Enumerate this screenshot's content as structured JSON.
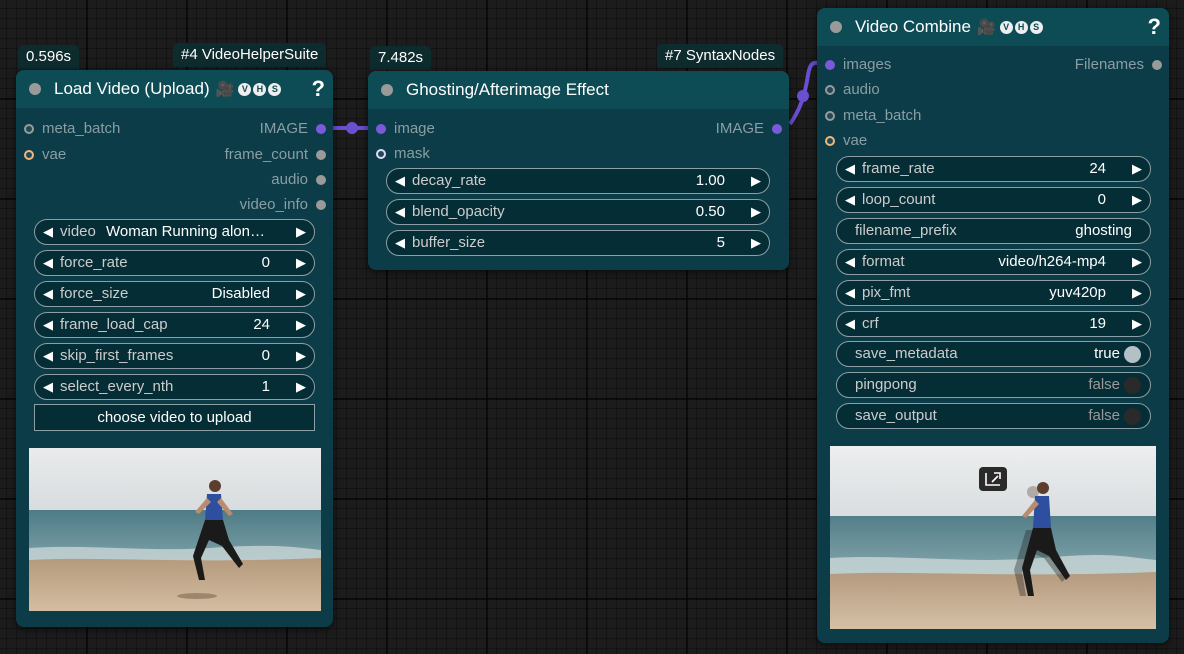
{
  "colors": {
    "node_bg": "#0b3c48",
    "node_header": "#0d4b55",
    "link": "#6a4fd1",
    "badge": "#0e2b2d"
  },
  "node_load": {
    "time": "0.596s",
    "id_badge": "#4 VideoHelperSuite",
    "title": "Load Video (Upload)",
    "help": "?",
    "inputs": [
      "meta_batch",
      "vae"
    ],
    "outputs": [
      "IMAGE",
      "frame_count",
      "audio",
      "video_info"
    ],
    "widgets": [
      {
        "label": "video",
        "value": "Woman Running alon…"
      },
      {
        "label": "force_rate",
        "value": "0"
      },
      {
        "label": "force_size",
        "value": "Disabled"
      },
      {
        "label": "frame_load_cap",
        "value": "24"
      },
      {
        "label": "skip_first_frames",
        "value": "0"
      },
      {
        "label": "select_every_nth",
        "value": "1"
      }
    ],
    "upload_button": "choose video to upload"
  },
  "node_ghost": {
    "time": "7.482s",
    "id_badge": "#7 SyntaxNodes",
    "title": "Ghosting/Afterimage Effect",
    "inputs": [
      "image",
      "mask"
    ],
    "outputs": [
      "IMAGE"
    ],
    "widgets": [
      {
        "label": "decay_rate",
        "value": "1.00"
      },
      {
        "label": "blend_opacity",
        "value": "0.50"
      },
      {
        "label": "buffer_size",
        "value": "5"
      }
    ]
  },
  "node_combine": {
    "title": "Video Combine",
    "help": "?",
    "inputs": [
      "images",
      "audio",
      "meta_batch",
      "vae"
    ],
    "outputs": [
      "Filenames"
    ],
    "widgets": [
      {
        "label": "frame_rate",
        "value": "24"
      },
      {
        "label": "loop_count",
        "value": "0"
      },
      {
        "label": "filename_prefix",
        "value": "ghosting"
      },
      {
        "label": "format",
        "value": "video/h264-mp4"
      },
      {
        "label": "pix_fmt",
        "value": "yuv420p"
      },
      {
        "label": "crf",
        "value": "19"
      },
      {
        "label": "save_metadata",
        "value": "true"
      },
      {
        "label": "pingpong",
        "value": "false"
      },
      {
        "label": "save_output",
        "value": "false"
      }
    ]
  }
}
